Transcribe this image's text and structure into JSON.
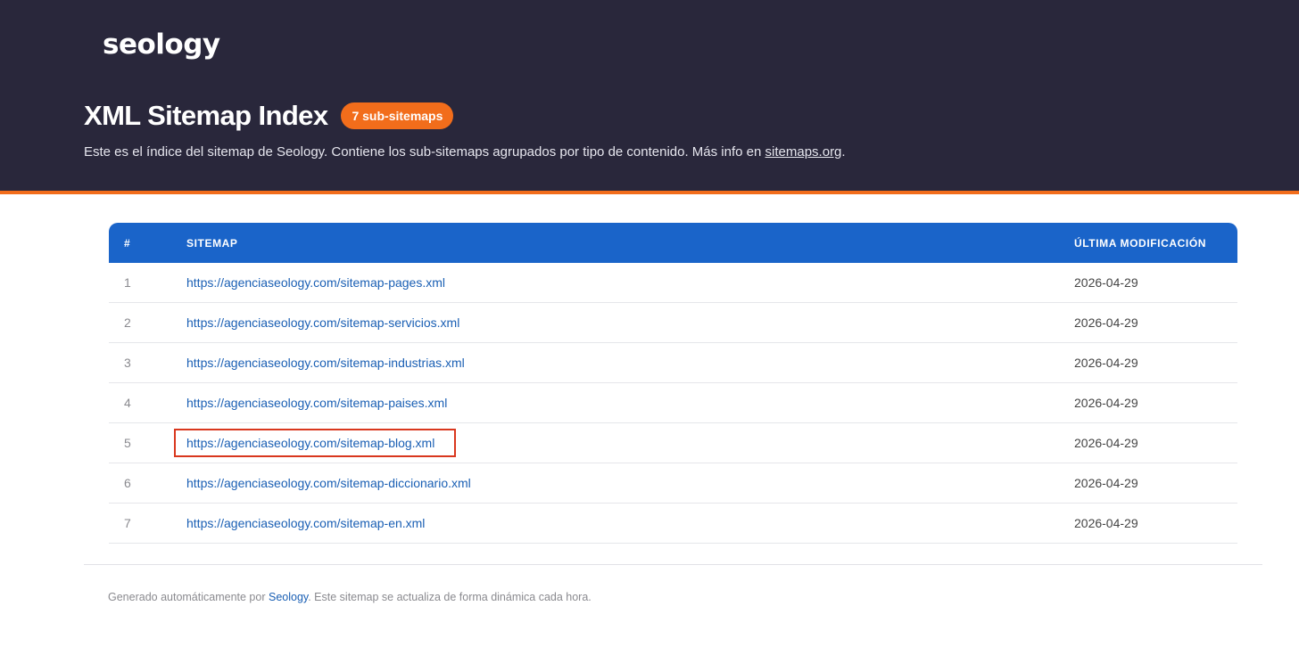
{
  "header": {
    "logo_text": "seology",
    "title": "XML Sitemap Index",
    "badge": "7 sub-sitemaps",
    "description": "Este es el índice del sitemap de Seology. Contiene los sub-sitemaps agrupados por tipo de contenido. Más info en",
    "description_link": "sitemaps.org",
    "description_end": "."
  },
  "table": {
    "columns": [
      "#",
      "SITEMAP",
      "ÚLTIMA MODIFICACIÓN"
    ],
    "rows": [
      {
        "num": "1",
        "url": "https://agenciaseology.com/sitemap-pages.xml",
        "date": "2026-04-29"
      },
      {
        "num": "2",
        "url": "https://agenciaseology.com/sitemap-servicios.xml",
        "date": "2026-04-29"
      },
      {
        "num": "3",
        "url": "https://agenciaseology.com/sitemap-industrias.xml",
        "date": "2026-04-29"
      },
      {
        "num": "4",
        "url": "https://agenciaseology.com/sitemap-paises.xml",
        "date": "2026-04-29"
      },
      {
        "num": "5",
        "url": "https://agenciaseology.com/sitemap-blog.xml",
        "date": "2026-04-29"
      },
      {
        "num": "6",
        "url": "https://agenciaseology.com/sitemap-diccionario.xml",
        "date": "2026-04-29"
      },
      {
        "num": "7",
        "url": "https://agenciaseology.com/sitemap-en.xml",
        "date": "2026-04-29"
      }
    ]
  },
  "footer": {
    "prefix": "Generado automáticamente por",
    "link": "Seology",
    "suffix": ". Este sitemap se actualiza de forma dinámica cada hora."
  },
  "colors": {
    "header_bg": "#29273b",
    "accent": "#f26d1b",
    "table_header": "#1a64c9",
    "link": "#1a5fb4",
    "highlight_border": "#d9371e"
  }
}
